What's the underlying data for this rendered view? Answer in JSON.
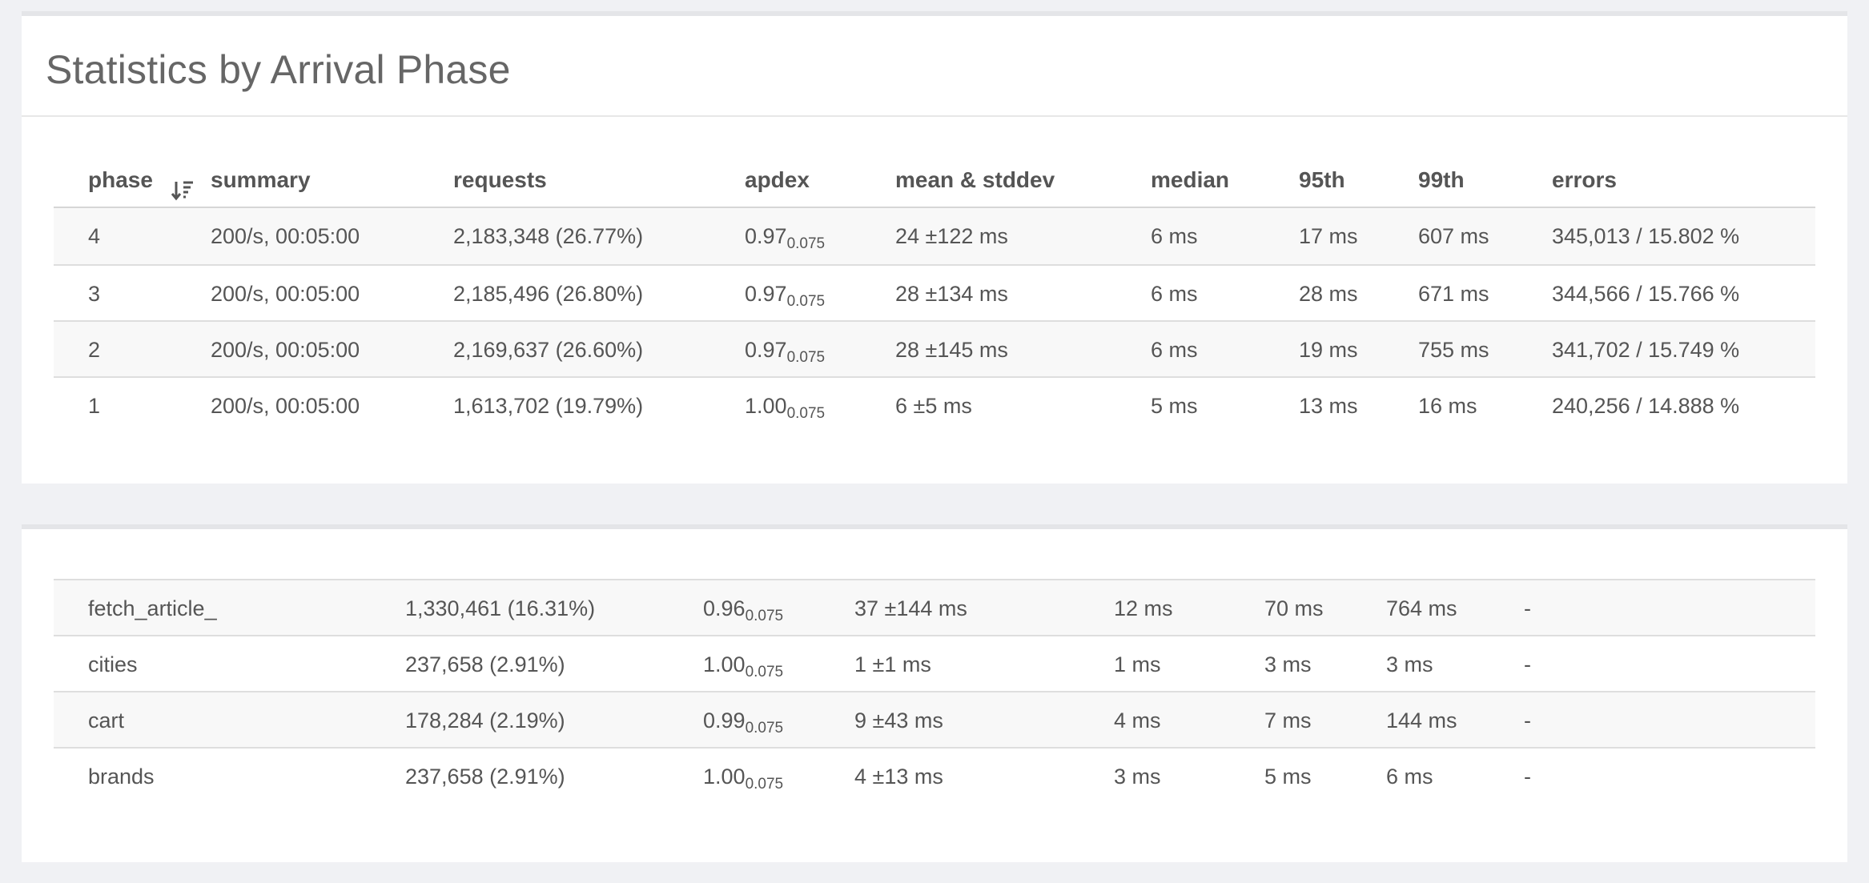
{
  "phase_panel": {
    "title": "Statistics by Arrival Phase",
    "columns": {
      "phase": "phase",
      "summary": "summary",
      "requests": "requests",
      "apdex": "apdex",
      "mean": "mean & stddev",
      "median": "median",
      "p95": "95th",
      "p99": "99th",
      "errors": "errors"
    },
    "sort_icon": "sort-descending-icon",
    "rows": [
      {
        "phase": "4",
        "summary": "200/s, 00:05:00",
        "requests": "2,183,348 (26.77%)",
        "apdex": "0.97",
        "apdex_t": "0.075",
        "mean": "24 ±122 ms",
        "median": "6 ms",
        "p95": "17 ms",
        "p99": "607 ms",
        "errors": "345,013 / 15.802 %"
      },
      {
        "phase": "3",
        "summary": "200/s, 00:05:00",
        "requests": "2,185,496 (26.80%)",
        "apdex": "0.97",
        "apdex_t": "0.075",
        "mean": "28 ±134 ms",
        "median": "6 ms",
        "p95": "28 ms",
        "p99": "671 ms",
        "errors": "344,566 / 15.766 %"
      },
      {
        "phase": "2",
        "summary": "200/s, 00:05:00",
        "requests": "2,169,637 (26.60%)",
        "apdex": "0.97",
        "apdex_t": "0.075",
        "mean": "28 ±145 ms",
        "median": "6 ms",
        "p95": "19 ms",
        "p99": "755 ms",
        "errors": "341,702 / 15.749 %"
      },
      {
        "phase": "1",
        "summary": "200/s, 00:05:00",
        "requests": "1,613,702 (19.79%)",
        "apdex": "1.00",
        "apdex_t": "0.075",
        "mean": "6 ±5 ms",
        "median": "5 ms",
        "p95": "13 ms",
        "p99": "16 ms",
        "errors": "240,256 / 14.888 %"
      }
    ]
  },
  "endpoint_panel": {
    "rows": [
      {
        "name": "fetch_article_",
        "requests": "1,330,461 (16.31%)",
        "apdex": "0.96",
        "apdex_t": "0.075",
        "mean": "37 ±144 ms",
        "median": "12 ms",
        "p95": "70 ms",
        "p99": "764 ms",
        "errors": "-"
      },
      {
        "name": "cities",
        "requests": "237,658 (2.91%)",
        "apdex": "1.00",
        "apdex_t": "0.075",
        "mean": "1 ±1 ms",
        "median": "1 ms",
        "p95": "3 ms",
        "p99": "3 ms",
        "errors": "-"
      },
      {
        "name": "cart",
        "requests": "178,284 (2.19%)",
        "apdex": "0.99",
        "apdex_t": "0.075",
        "mean": "9 ±43 ms",
        "median": "4 ms",
        "p95": "7 ms",
        "p99": "144 ms",
        "errors": "-"
      },
      {
        "name": "brands",
        "requests": "237,658 (2.91%)",
        "apdex": "1.00",
        "apdex_t": "0.075",
        "mean": "4 ±13 ms",
        "median": "3 ms",
        "p95": "5 ms",
        "p99": "6 ms",
        "errors": "-"
      }
    ]
  }
}
